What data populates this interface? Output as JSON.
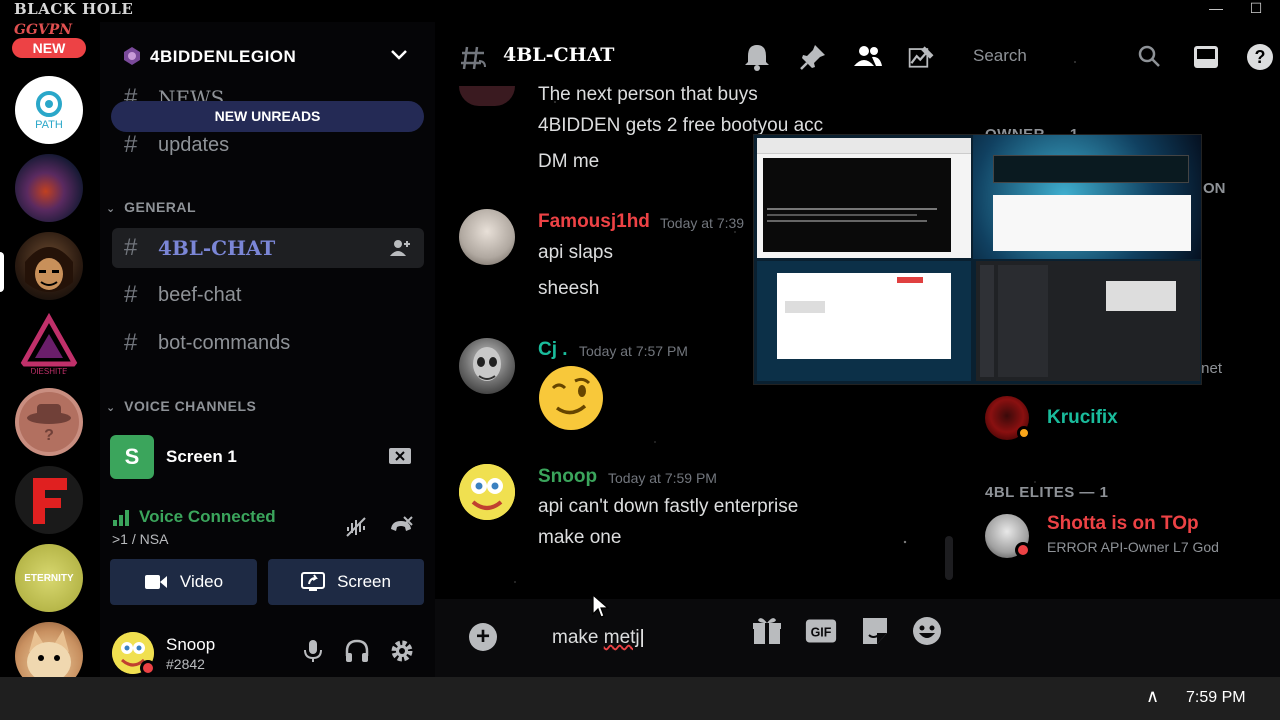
{
  "titlebar": {
    "brand": "BLACK HOLE",
    "brand_sub": "GGVPN",
    "minimize": "—",
    "maximize": "☐"
  },
  "rail": {
    "new_badge": "NEW",
    "servers": [
      {
        "name": "PATH",
        "label": "PATH",
        "color": "#ffffff"
      },
      {
        "name": "planet",
        "label": "",
        "color": "#3a2a4a"
      },
      {
        "name": "avatar-anime",
        "label": "",
        "color": "#2a1a10"
      },
      {
        "name": "gaming",
        "label": "DIESHITE",
        "color": "#000000"
      },
      {
        "name": "unknown",
        "label": "Unknown",
        "color": "#c98e80"
      },
      {
        "name": "f-server",
        "label": "F",
        "color": "#1a1a1a"
      },
      {
        "name": "eternity",
        "label": "ETERNITY",
        "color": "#c8c850"
      },
      {
        "name": "cat",
        "label": "",
        "color": "#d8a060"
      }
    ]
  },
  "sidebar": {
    "guild_name": "4BIDDENLEGION",
    "new_unreads": "NEW UNREADS",
    "channels_top": [
      {
        "name": "NEWS"
      },
      {
        "name": "updates"
      }
    ],
    "category_general": "GENERAL",
    "channels_general": [
      {
        "name": "4BL-CHAT",
        "active": true
      },
      {
        "name": "beef-chat"
      },
      {
        "name": "bot-commands"
      }
    ],
    "category_voice": "VOICE CHANNELS",
    "voice_channel": {
      "name": "Screen 1",
      "avatar_letter": "S"
    },
    "voice_connected": {
      "status": "Voice Connected",
      "sub": ">1 / NSA"
    },
    "buttons": {
      "video": "Video",
      "screen": "Screen"
    },
    "user": {
      "name": "Snoop",
      "tag": "#2842"
    }
  },
  "chat": {
    "channel_name": "4BL-CHAT",
    "search_placeholder": "Search",
    "messages": [
      {
        "lines": [
          "The next person that buys",
          "4BIDDEN gets 2 free bootyou acc",
          "DM me"
        ]
      },
      {
        "author": "Famousj1hd",
        "author_color": "#ed4245",
        "time": "Today at 7:39",
        "lines": [
          "api slaps",
          "sheesh"
        ]
      },
      {
        "author": "Cj .",
        "author_color": "#1abc9c",
        "time": "Today at 7:57 PM",
        "emoji": "😉"
      },
      {
        "author": "Snoop",
        "author_color": "#3ba55c",
        "time": "Today at 7:59 PM",
        "lines": [
          "api can't down fastly enterprise",
          "make one"
        ]
      }
    ],
    "composer": {
      "text_prefix": "make ",
      "text_misspelled": "metj"
    },
    "members": {
      "owner_label": "OWNER — 1",
      "partial_on": "ON",
      "partial_net": ".net",
      "krucifix": "Krucifix",
      "elites_label": "4BL ELITES — 1",
      "shotta_name": "Shotta is on TOp",
      "shotta_status": "ERROR API-Owner L7 God"
    }
  },
  "taskbar": {
    "time": "7:59 PM",
    "tray_arrow": "∧"
  }
}
